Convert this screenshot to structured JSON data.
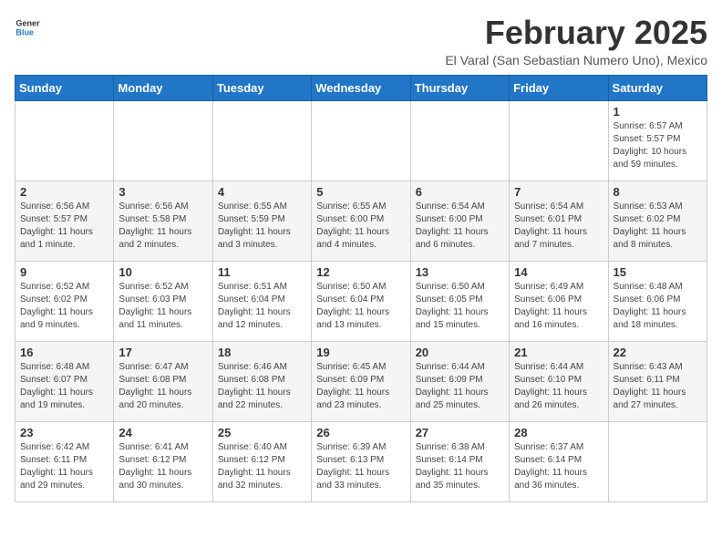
{
  "logo": {
    "general": "General",
    "blue": "Blue"
  },
  "header": {
    "month": "February 2025",
    "location": "El Varal (San Sebastian Numero Uno), Mexico"
  },
  "weekdays": [
    "Sunday",
    "Monday",
    "Tuesday",
    "Wednesday",
    "Thursday",
    "Friday",
    "Saturday"
  ],
  "weeks": [
    [
      {
        "day": "",
        "info": ""
      },
      {
        "day": "",
        "info": ""
      },
      {
        "day": "",
        "info": ""
      },
      {
        "day": "",
        "info": ""
      },
      {
        "day": "",
        "info": ""
      },
      {
        "day": "",
        "info": ""
      },
      {
        "day": "1",
        "info": "Sunrise: 6:57 AM\nSunset: 5:57 PM\nDaylight: 10 hours\nand 59 minutes."
      }
    ],
    [
      {
        "day": "2",
        "info": "Sunrise: 6:56 AM\nSunset: 5:57 PM\nDaylight: 11 hours\nand 1 minute."
      },
      {
        "day": "3",
        "info": "Sunrise: 6:56 AM\nSunset: 5:58 PM\nDaylight: 11 hours\nand 2 minutes."
      },
      {
        "day": "4",
        "info": "Sunrise: 6:55 AM\nSunset: 5:59 PM\nDaylight: 11 hours\nand 3 minutes."
      },
      {
        "day": "5",
        "info": "Sunrise: 6:55 AM\nSunset: 6:00 PM\nDaylight: 11 hours\nand 4 minutes."
      },
      {
        "day": "6",
        "info": "Sunrise: 6:54 AM\nSunset: 6:00 PM\nDaylight: 11 hours\nand 6 minutes."
      },
      {
        "day": "7",
        "info": "Sunrise: 6:54 AM\nSunset: 6:01 PM\nDaylight: 11 hours\nand 7 minutes."
      },
      {
        "day": "8",
        "info": "Sunrise: 6:53 AM\nSunset: 6:02 PM\nDaylight: 11 hours\nand 8 minutes."
      }
    ],
    [
      {
        "day": "9",
        "info": "Sunrise: 6:52 AM\nSunset: 6:02 PM\nDaylight: 11 hours\nand 9 minutes."
      },
      {
        "day": "10",
        "info": "Sunrise: 6:52 AM\nSunset: 6:03 PM\nDaylight: 11 hours\nand 11 minutes."
      },
      {
        "day": "11",
        "info": "Sunrise: 6:51 AM\nSunset: 6:04 PM\nDaylight: 11 hours\nand 12 minutes."
      },
      {
        "day": "12",
        "info": "Sunrise: 6:50 AM\nSunset: 6:04 PM\nDaylight: 11 hours\nand 13 minutes."
      },
      {
        "day": "13",
        "info": "Sunrise: 6:50 AM\nSunset: 6:05 PM\nDaylight: 11 hours\nand 15 minutes."
      },
      {
        "day": "14",
        "info": "Sunrise: 6:49 AM\nSunset: 6:06 PM\nDaylight: 11 hours\nand 16 minutes."
      },
      {
        "day": "15",
        "info": "Sunrise: 6:48 AM\nSunset: 6:06 PM\nDaylight: 11 hours\nand 18 minutes."
      }
    ],
    [
      {
        "day": "16",
        "info": "Sunrise: 6:48 AM\nSunset: 6:07 PM\nDaylight: 11 hours\nand 19 minutes."
      },
      {
        "day": "17",
        "info": "Sunrise: 6:47 AM\nSunset: 6:08 PM\nDaylight: 11 hours\nand 20 minutes."
      },
      {
        "day": "18",
        "info": "Sunrise: 6:46 AM\nSunset: 6:08 PM\nDaylight: 11 hours\nand 22 minutes."
      },
      {
        "day": "19",
        "info": "Sunrise: 6:45 AM\nSunset: 6:09 PM\nDaylight: 11 hours\nand 23 minutes."
      },
      {
        "day": "20",
        "info": "Sunrise: 6:44 AM\nSunset: 6:09 PM\nDaylight: 11 hours\nand 25 minutes."
      },
      {
        "day": "21",
        "info": "Sunrise: 6:44 AM\nSunset: 6:10 PM\nDaylight: 11 hours\nand 26 minutes."
      },
      {
        "day": "22",
        "info": "Sunrise: 6:43 AM\nSunset: 6:11 PM\nDaylight: 11 hours\nand 27 minutes."
      }
    ],
    [
      {
        "day": "23",
        "info": "Sunrise: 6:42 AM\nSunset: 6:11 PM\nDaylight: 11 hours\nand 29 minutes."
      },
      {
        "day": "24",
        "info": "Sunrise: 6:41 AM\nSunset: 6:12 PM\nDaylight: 11 hours\nand 30 minutes."
      },
      {
        "day": "25",
        "info": "Sunrise: 6:40 AM\nSunset: 6:12 PM\nDaylight: 11 hours\nand 32 minutes."
      },
      {
        "day": "26",
        "info": "Sunrise: 6:39 AM\nSunset: 6:13 PM\nDaylight: 11 hours\nand 33 minutes."
      },
      {
        "day": "27",
        "info": "Sunrise: 6:38 AM\nSunset: 6:14 PM\nDaylight: 11 hours\nand 35 minutes."
      },
      {
        "day": "28",
        "info": "Sunrise: 6:37 AM\nSunset: 6:14 PM\nDaylight: 11 hours\nand 36 minutes."
      },
      {
        "day": "",
        "info": ""
      }
    ]
  ]
}
